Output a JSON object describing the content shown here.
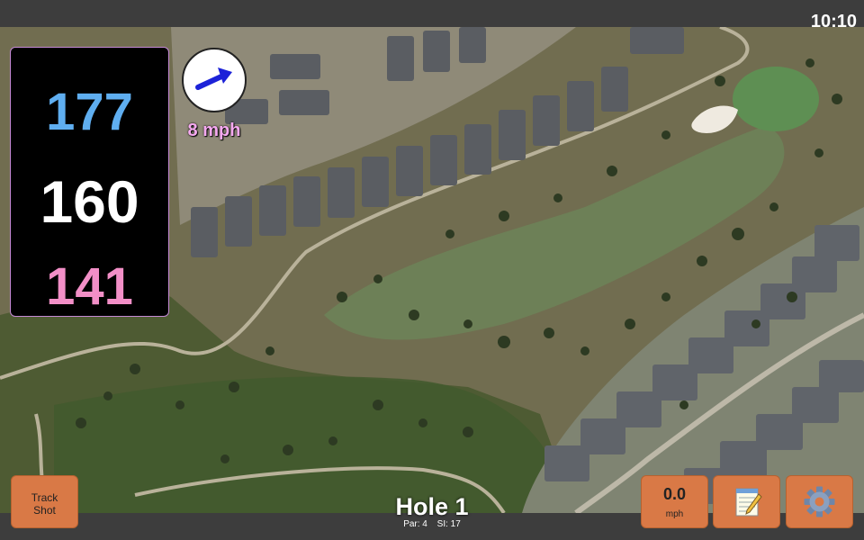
{
  "status_bar": {
    "time": "10:10"
  },
  "yardages": {
    "back": "177",
    "center": "160",
    "front": "141"
  },
  "wind": {
    "speed_label": "8 mph",
    "direction_icon": "wind-arrow-icon"
  },
  "track_shot": {
    "line1": "Track",
    "line2": "Shot"
  },
  "hole": {
    "title": "Hole 1",
    "par_label": "Par: 4",
    "si_label": "SI: 17"
  },
  "shot_speed": {
    "value": "0.0",
    "unit": "mph"
  },
  "icons": {
    "notes": "notepad-icon",
    "settings": "gear-icon"
  },
  "colors": {
    "back_yardage": "#5faef0",
    "center_yardage": "#ffffff",
    "front_yardage": "#f28fc7",
    "wind_label": "#f5a9f0",
    "button_bg": "#d97946",
    "wind_arrow": "#1c22d8"
  }
}
